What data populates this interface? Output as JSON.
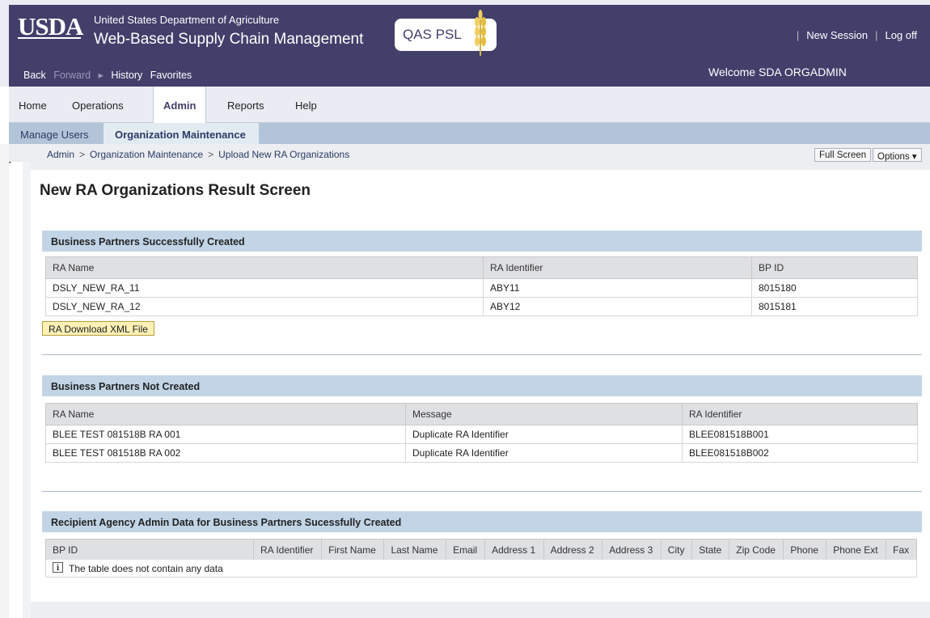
{
  "header": {
    "logo": "USDA",
    "agency": "United States Department of Agriculture",
    "app_title": "Web-Based Supply Chain Management",
    "badge": "QAS PSL",
    "new_session": "New Session",
    "log_off": "Log off",
    "welcome": "Welcome SDA ORGADMIN",
    "nav": {
      "back": "Back",
      "forward": "Forward",
      "history": "History",
      "favorites": "Favorites"
    }
  },
  "tabs": [
    "Home",
    "Operations",
    "Admin",
    "Reports",
    "Help"
  ],
  "active_tab": "Admin",
  "subtabs": [
    "Manage Users",
    "Organization Maintenance"
  ],
  "active_subtab": "Organization Maintenance",
  "breadcrumb": [
    "Admin",
    "Organization Maintenance",
    "Upload New RA Organizations"
  ],
  "toolbar": {
    "full_screen": "Full Screen",
    "options": "Options ▾"
  },
  "page_title": "New RA Organizations Result Screen",
  "created": {
    "title": "Business Partners Successfully Created",
    "columns": [
      "RA Name",
      "RA Identifier",
      "BP ID"
    ],
    "rows": [
      [
        "DSLY_NEW_RA_11",
        "ABY11",
        "8015180"
      ],
      [
        "DSLY_NEW_RA_12",
        "ABY12",
        "8015181"
      ]
    ],
    "download_label": "RA Download XML File"
  },
  "not_created": {
    "title": "Business Partners Not Created",
    "columns": [
      "RA Name",
      "Message",
      "RA Identifier"
    ],
    "rows": [
      [
        "BLEE TEST 081518B RA 001",
        "Duplicate RA Identifier",
        "BLEE081518B001"
      ],
      [
        "BLEE TEST 081518B RA 002",
        "Duplicate RA Identifier",
        "BLEE081518B002"
      ]
    ]
  },
  "admin_data": {
    "title": "Recipient Agency Admin Data for Business Partners Sucessfully Created",
    "columns": [
      "BP ID",
      "RA Identifier",
      "First Name",
      "Last Name",
      "Email",
      "Address 1",
      "Address 2",
      "Address 3",
      "City",
      "State",
      "Zip Code",
      "Phone",
      "Phone Ext",
      "Fax"
    ],
    "empty_text": "The table does not contain any data"
  },
  "colors": {
    "header": "#423f6b",
    "section": "#c2d5e7",
    "subnav": "#b2c5d8"
  }
}
